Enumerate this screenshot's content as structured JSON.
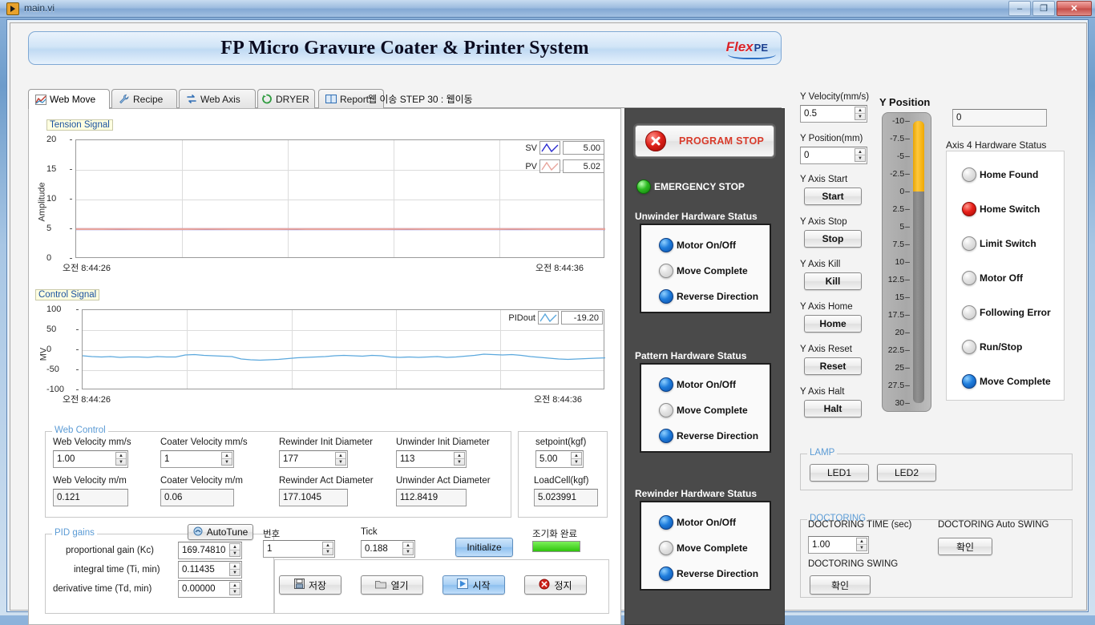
{
  "window": {
    "title": "main.vi",
    "icon": "labview-vi-icon",
    "minimize": "–",
    "maximize": "❐",
    "close": "✕"
  },
  "banner": {
    "title": "FP  Micro Gravure Coater & Printer System",
    "logo_flex": "Flex",
    "logo_pe": "PE"
  },
  "tabs": [
    {
      "label": "Web Move",
      "icon": "chart-icon",
      "active": true
    },
    {
      "label": "Recipe",
      "icon": "wrench-icon",
      "active": false
    },
    {
      "label": "Web Axis",
      "icon": "swap-arrows-icon",
      "active": false
    },
    {
      "label": "DRYER",
      "icon": "recycle-icon",
      "active": false
    },
    {
      "label": "Report",
      "icon": "book-icon",
      "active": false
    }
  ],
  "tab_status": "웹 이송 STEP 30 : 웹이동",
  "chart_data": [
    {
      "type": "line",
      "title": "Tension Signal",
      "ylabel": "Amplitude",
      "xlabel": "",
      "ylim": [
        0,
        20
      ],
      "yticks": [
        0,
        5,
        10,
        15,
        20
      ],
      "x_start_label": "오전 8:44:26",
      "x_end_label": "오전 8:44:36",
      "grid": true,
      "legend_position": "top-right",
      "series": [
        {
          "name": "SV",
          "value": "5.00",
          "color": "#2a2ad0",
          "values": [
            5.0,
            5.0,
            5.0,
            5.0,
            5.0,
            5.0,
            5.0,
            5.0,
            5.0,
            5.0,
            5.0,
            5.0,
            5.0,
            5.0,
            5.0,
            5.0,
            5.0,
            5.0,
            5.0,
            5.0,
            5.0,
            5.0,
            5.0,
            5.0,
            5.0
          ]
        },
        {
          "name": "PV",
          "value": "5.02",
          "color": "#e8a49c",
          "values": [
            5.02,
            5.01,
            5.03,
            5.02,
            5.0,
            5.02,
            5.03,
            5.01,
            5.02,
            5.02,
            5.03,
            5.01,
            5.02,
            5.02,
            5.01,
            5.03,
            5.02,
            5.02,
            5.01,
            5.02,
            5.03,
            5.02,
            5.01,
            5.02,
            5.02
          ]
        }
      ]
    },
    {
      "type": "line",
      "title": "Control Signal",
      "ylabel": "MV",
      "xlabel": "",
      "ylim": [
        -100,
        100
      ],
      "yticks": [
        -100,
        -50,
        0,
        50,
        100
      ],
      "x_start_label": "오전 8:44:26",
      "x_end_label": "오전 8:44:36",
      "grid": true,
      "legend_position": "top-right",
      "series": [
        {
          "name": "PIDout",
          "value": "-19.20",
          "color": "#5ba8dd",
          "values": [
            -14,
            -16,
            -17,
            -16,
            -18,
            -17,
            -17,
            -18,
            -16,
            -17,
            -17,
            -12,
            -11,
            -13,
            -14,
            -15,
            -16,
            -22,
            -24,
            -25,
            -24,
            -23,
            -21,
            -19,
            -18,
            -17,
            -16,
            -14,
            -13,
            -14,
            -15,
            -13,
            -14,
            -17,
            -18,
            -17,
            -18,
            -17,
            -16,
            -18,
            -17,
            -15,
            -13,
            -10,
            -11,
            -12,
            -11,
            -13,
            -16,
            -18,
            -20,
            -22,
            -23,
            -22,
            -21,
            -20,
            -19.2
          ]
        }
      ]
    }
  ],
  "web_control": {
    "section_label": "Web Control",
    "fields": [
      {
        "label": "Web Velocity mm/s",
        "value": "1.00",
        "spinner": true
      },
      {
        "label": "Coater Velocity mm/s",
        "value": "1",
        "spinner": true
      },
      {
        "label": "Rewinder Init Diameter",
        "value": "177",
        "spinner": true
      },
      {
        "label": "Unwinder Init Diameter",
        "value": "113",
        "spinner": true
      },
      {
        "label": "Web Velocity m/m",
        "value": "0.121",
        "spinner": false
      },
      {
        "label": "Coater Velocity m/m",
        "value": "0.06",
        "spinner": false
      },
      {
        "label": "Rewinder Act Diameter",
        "value": "177.1045",
        "spinner": false
      },
      {
        "label": "Unwinder Act Diameter",
        "value": "112.8419",
        "spinner": false
      }
    ],
    "setpoint_label": "setpoint(kgf)",
    "setpoint_value": "5.00",
    "loadcell_label": "LoadCell(kgf)",
    "loadcell_value": "5.023991"
  },
  "pid": {
    "section_label": "PID gains",
    "autotune_label": "AutoTune",
    "rows": [
      {
        "label": "proportional gain (Kc)",
        "value": "169.74810"
      },
      {
        "label": "integral time (Ti, min)",
        "value": "0.11435"
      },
      {
        "label": "derivative time (Td, min)",
        "value": "0.00000"
      }
    ],
    "number_label": "번호",
    "number_value": "1",
    "tick_label": "Tick",
    "tick_value": "0.188",
    "initialize_label": "Initialize",
    "init_status_label": "조기화 완료",
    "init_progress_percent": 100,
    "init_progress_color": "#3ddc18",
    "actions": [
      {
        "label": "저장",
        "icon": "save-icon"
      },
      {
        "label": "열기",
        "icon": "folder-icon"
      },
      {
        "label": "시작",
        "icon": "play-icon"
      },
      {
        "label": "정지",
        "icon": "stop-icon"
      }
    ]
  },
  "status_column": {
    "program_stop_label": "PROGRAM STOP",
    "program_stop_color": "#d83a2a",
    "emergency_stop_label": "EMERGENCY STOP",
    "emergency_stop_state": "green",
    "panels": [
      {
        "title": "Unwinder Hardware Status",
        "leds": [
          {
            "label": "Motor On/Off",
            "state": "blue"
          },
          {
            "label": "Move Complete",
            "state": "off"
          },
          {
            "label": "Reverse Direction",
            "state": "blue"
          }
        ]
      },
      {
        "title": "Pattern Hardware Status",
        "leds": [
          {
            "label": "Motor On/Off",
            "state": "blue"
          },
          {
            "label": "Move Complete",
            "state": "off"
          },
          {
            "label": "Reverse Direction",
            "state": "blue"
          }
        ]
      },
      {
        "title": "Rewinder Hardware Status",
        "leds": [
          {
            "label": "Motor On/Off",
            "state": "blue"
          },
          {
            "label": "Move Complete",
            "state": "off"
          },
          {
            "label": "Reverse Direction",
            "state": "blue"
          }
        ]
      }
    ]
  },
  "y_axis": {
    "velocity_label": "Y Velocity(mm/s)",
    "velocity_value": "0.5",
    "position_label": "Y Position(mm)",
    "position_value": "0",
    "buttons": [
      {
        "caption": "Y Axis Start",
        "label": "Start"
      },
      {
        "caption": "Y Axis Stop",
        "label": "Stop"
      },
      {
        "caption": "Y Axis Kill",
        "label": "Kill"
      },
      {
        "caption": "Y Axis Home",
        "label": "Home"
      },
      {
        "caption": "Y Axis Reset",
        "label": "Reset"
      },
      {
        "caption": "Y Axis Halt",
        "label": "Halt"
      }
    ]
  },
  "gauge": {
    "title": "Y Position",
    "ticks": [
      "-10",
      "-7.5",
      "-5",
      "-2.5",
      "0",
      "2.5",
      "5",
      "7.5",
      "10",
      "12.5",
      "15",
      "17.5",
      "20",
      "22.5",
      "25",
      "27.5",
      "30"
    ],
    "min": -10,
    "max": 30,
    "value": 0,
    "fill_color": "#ffc83c"
  },
  "axis4": {
    "readout_value": "0",
    "title": "Axis 4 Hardware Status",
    "leds": [
      {
        "label": "Home Found",
        "state": "off"
      },
      {
        "label": "Home Switch",
        "state": "red"
      },
      {
        "label": "Limit Switch",
        "state": "off"
      },
      {
        "label": "Motor Off",
        "state": "off"
      },
      {
        "label": "Following Error",
        "state": "off"
      },
      {
        "label": "Run/Stop",
        "state": "off"
      },
      {
        "label": "Move Complete",
        "state": "blue"
      }
    ]
  },
  "lamp": {
    "section_label": "LAMP",
    "buttons": [
      {
        "label": "LED1"
      },
      {
        "label": "LED2"
      }
    ]
  },
  "doctoring": {
    "section_label": "DOCTORING",
    "time_label": "DOCTORING TIME (sec)",
    "time_value": "1.00",
    "swing_label": "DOCTORING SWING",
    "swing_button": "확인",
    "auto_swing_label": "DOCTORING Auto SWING",
    "auto_swing_button": "확인"
  }
}
